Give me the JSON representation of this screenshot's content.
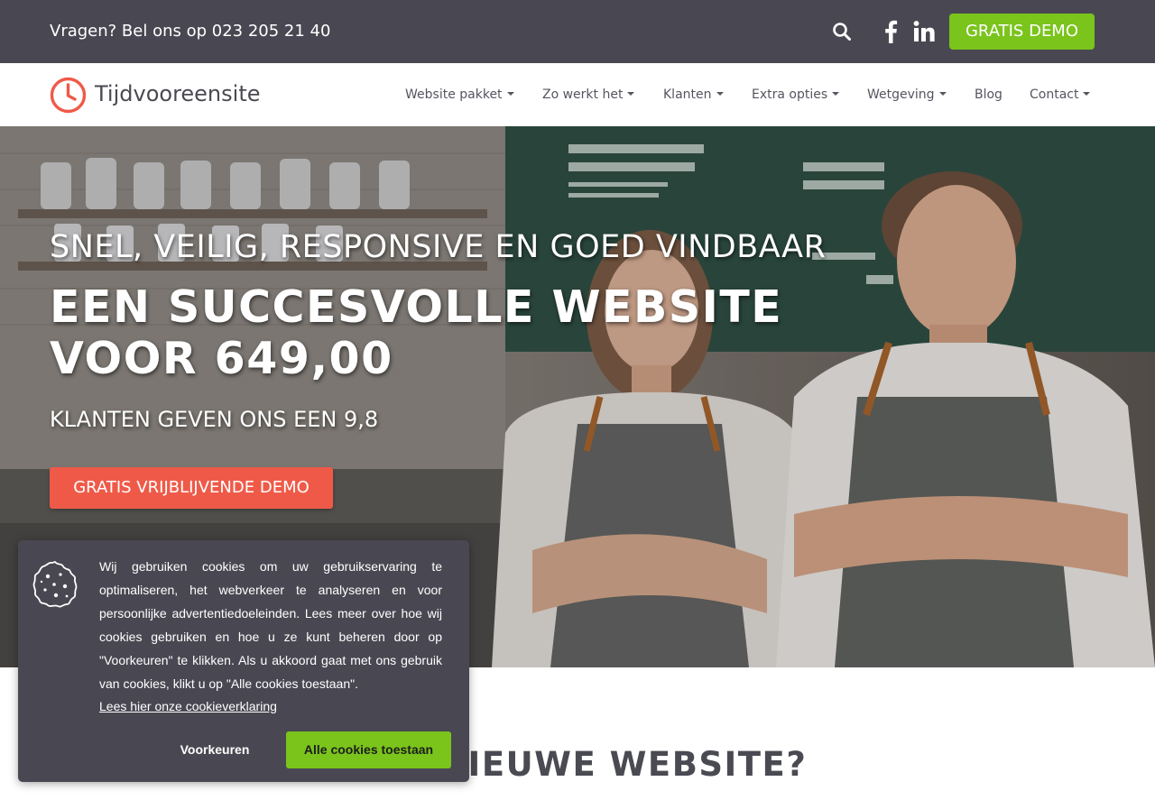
{
  "topbar": {
    "phone_text": "Vragen? Bel ons op 023 205 21 40",
    "demo_button": "GRATIS DEMO",
    "icons": [
      "search-icon",
      "facebook-icon",
      "linkedin-icon"
    ],
    "background_color": "#494852",
    "accent_color": "#7ac41c"
  },
  "navbar": {
    "logo_text": "Tijdvooreensite",
    "logo_icon": "clock-icon",
    "logo_color": "#ef5a48",
    "items": [
      {
        "label": "Website pakket",
        "has_dropdown": true
      },
      {
        "label": "Zo werkt het",
        "has_dropdown": true
      },
      {
        "label": "Klanten",
        "has_dropdown": true
      },
      {
        "label": "Extra opties",
        "has_dropdown": true
      },
      {
        "label": "Wetgeving",
        "has_dropdown": true
      },
      {
        "label": "Blog",
        "has_dropdown": false
      },
      {
        "label": "Contact",
        "has_dropdown": true
      }
    ]
  },
  "hero": {
    "tagline": "SNEL, VEILIG, RESPONSIVE EN GOED VINDBAAR",
    "headline": "EEN SUCCESVOLLE WEBSITE VOOR 649,00",
    "rating_text": "KLANTEN GEVEN ONS EEN 9,8",
    "cta_button": "GRATIS VRIJBLIJVENDE DEMO",
    "cta_color": "#ef5a48"
  },
  "section": {
    "heading": "EEN NIEUWE WEBSITE?"
  },
  "cookie_banner": {
    "icon": "cookie-icon",
    "text": "Wij gebruiken cookies om uw gebruikservaring te optimaliseren, het webverkeer te analyseren en voor persoonlijke advertentiedoeleinden. Lees meer over hoe wij cookies gebruiken en hoe u ze kunt beheren door op \"Voorkeuren\" te klikken. Als u akkoord gaat met ons gebruik van cookies, klikt u op \"Alle cookies toestaan\".",
    "link_text": "Lees hier onze cookieverklaring",
    "preferences_button": "Voorkeuren",
    "accept_button": "Alle cookies toestaan",
    "background_color": "#494852",
    "accept_color": "#7ac41c"
  }
}
